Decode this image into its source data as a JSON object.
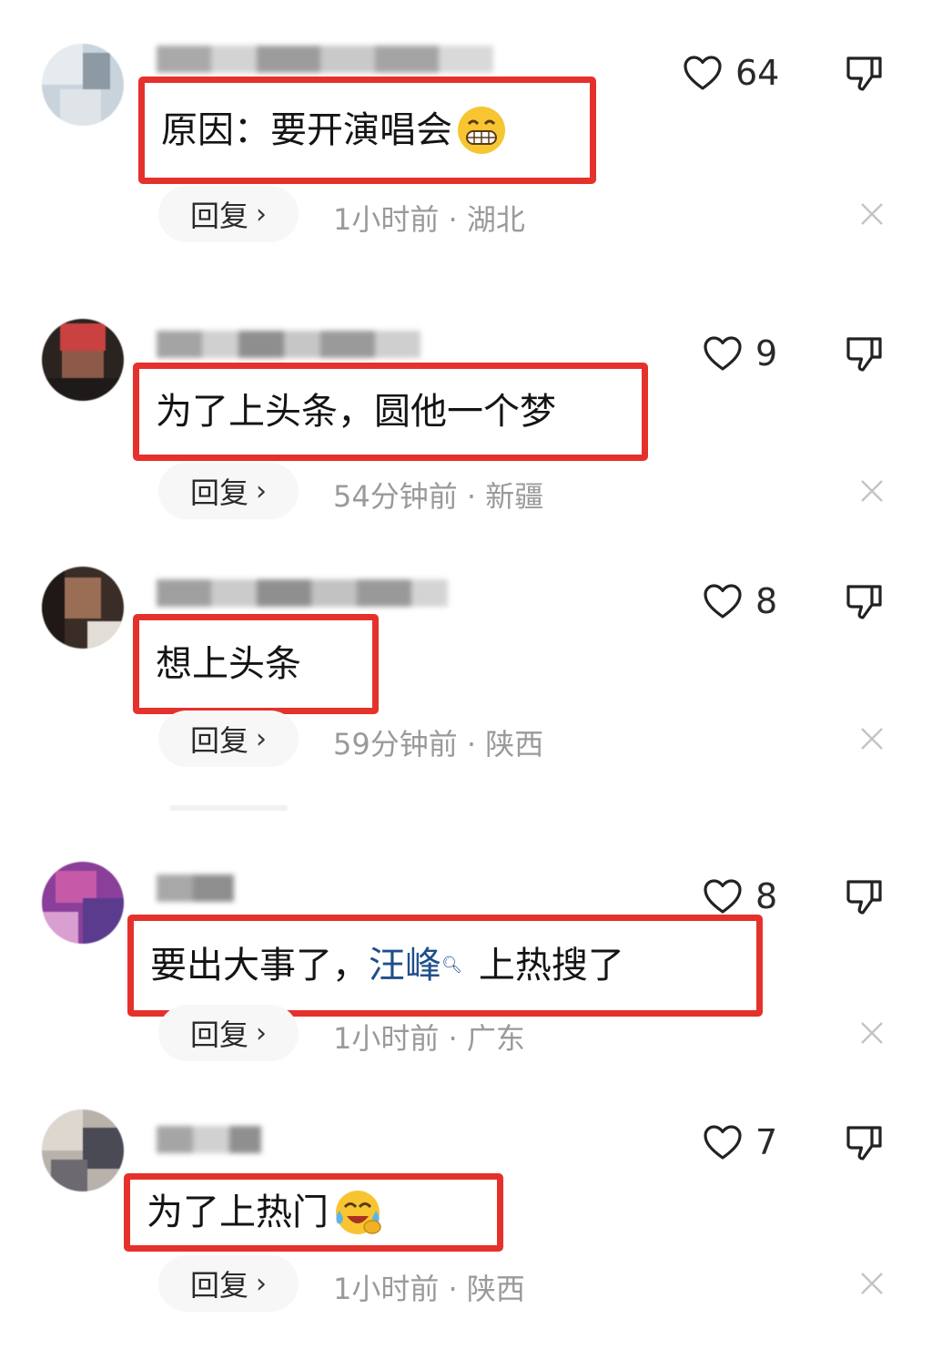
{
  "reply_label": "回复",
  "comments": [
    {
      "content": "原因：要开演唱会",
      "emoji": "grinning-emoji",
      "likes": "64",
      "time": "1小时前",
      "location": "湖北"
    },
    {
      "content": "为了上头条，圆他一个梦",
      "likes": "9",
      "time": "54分钟前",
      "location": "新疆"
    },
    {
      "content": "想上头条",
      "likes": "8",
      "time": "59分钟前",
      "location": "陕西"
    },
    {
      "content_before": "要出大事了，",
      "content_link": "汪峰",
      "content_after": "上热搜了",
      "likes": "8",
      "time": "1小时前",
      "location": "广东"
    },
    {
      "content": "为了上热门",
      "emoji": "laughing-crying-emoji",
      "likes": "7",
      "time": "1小时前",
      "location": "陕西"
    }
  ],
  "colors": {
    "highlight_border": "#e5312c",
    "link": "#1f4e8c",
    "meta_text": "#9a9a9a"
  }
}
